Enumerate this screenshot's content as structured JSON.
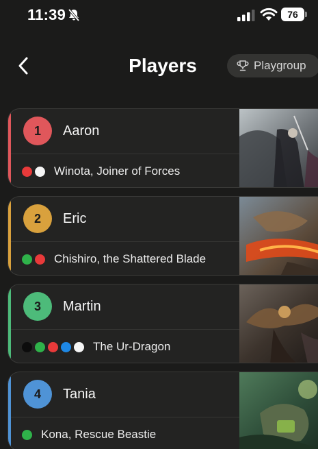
{
  "status_bar": {
    "time": "11:39",
    "battery": "76",
    "icons": [
      "bell-slash-icon",
      "signal-icon",
      "wifi-icon",
      "battery-icon"
    ]
  },
  "header": {
    "title": "Players",
    "back_icon": "chevron-left-icon",
    "playgroup_label": "Playgroup",
    "playgroup_icon": "trophy-icon"
  },
  "players": [
    {
      "seat": "1",
      "name": "Aaron",
      "commander": "Winota, Joiner of Forces",
      "accent": "#e0575b",
      "pips": [
        "#e83a3a",
        "#f5f5f5"
      ]
    },
    {
      "seat": "2",
      "name": "Eric",
      "commander": "Chishiro, the Shattered Blade",
      "accent": "#d9a13d",
      "pips": [
        "#2fb24a",
        "#e83a3a"
      ]
    },
    {
      "seat": "3",
      "name": "Martin",
      "commander": "The Ur-Dragon",
      "accent": "#4dbb7a",
      "pips": [
        "#0c0c0c",
        "#2fb24a",
        "#e83a3a",
        "#1e88e5",
        "#f5f5f5"
      ]
    },
    {
      "seat": "4",
      "name": "Tania",
      "commander": "Kona, Rescue Beastie",
      "accent": "#4f93d6",
      "pips": [
        "#2fb24a"
      ]
    }
  ]
}
